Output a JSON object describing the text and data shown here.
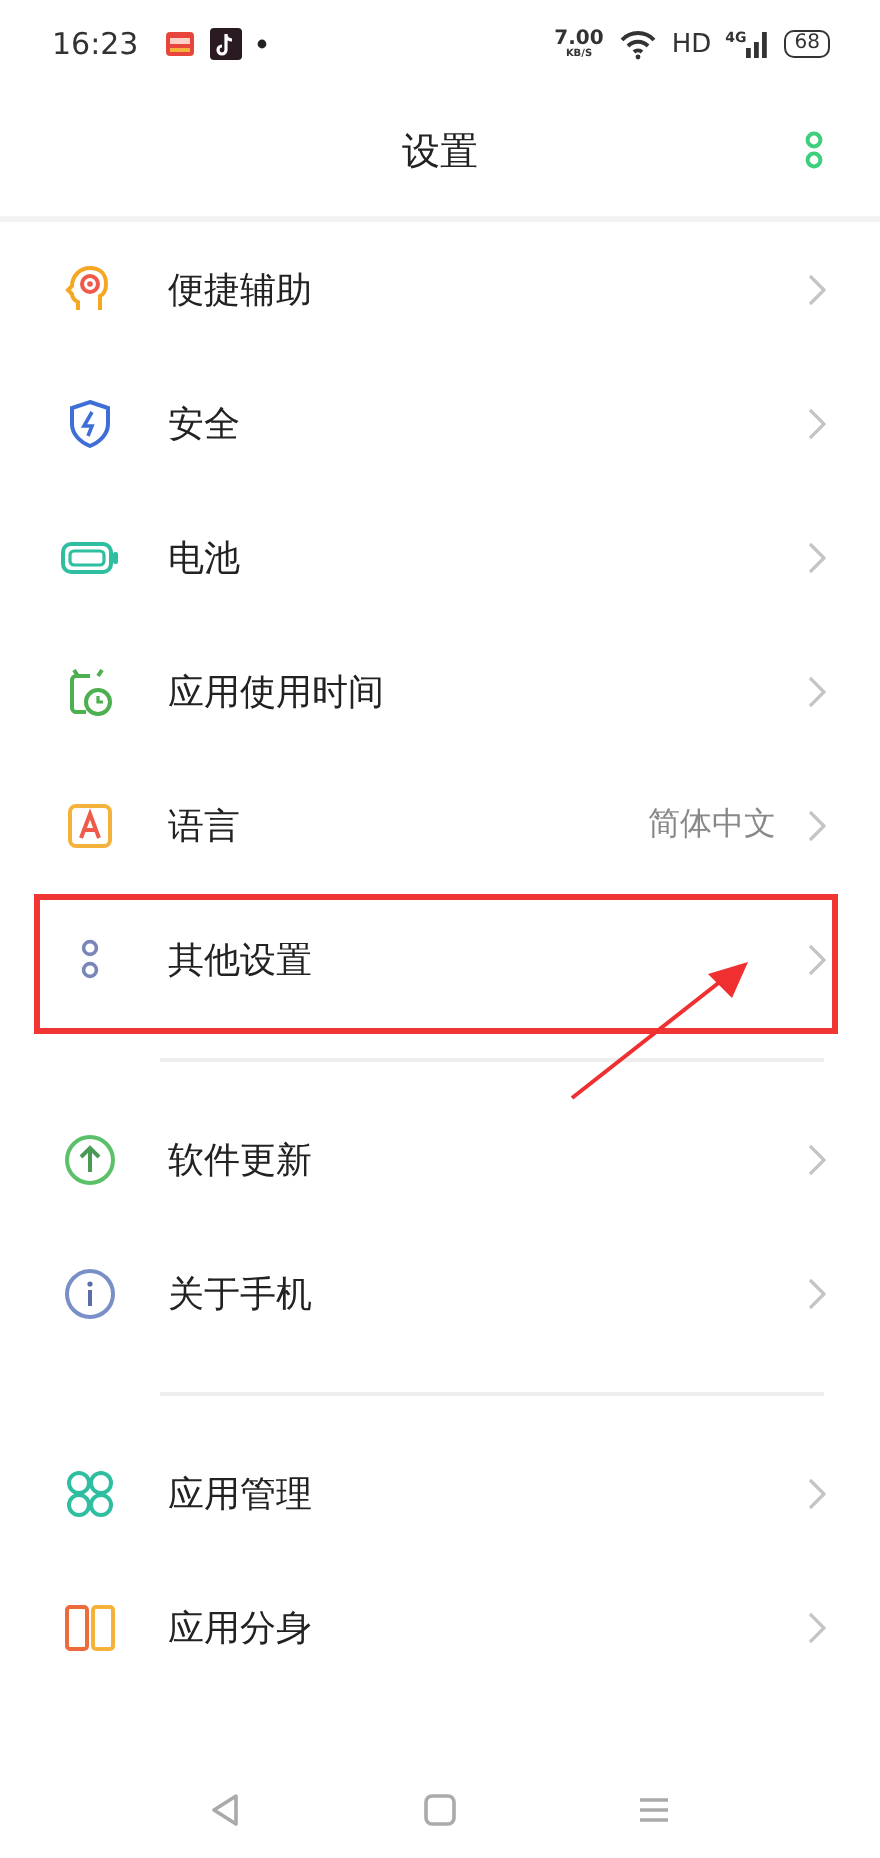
{
  "status_bar": {
    "time": "16:23",
    "net_speed": "7.00",
    "net_unit": "KB/S",
    "hd": "HD",
    "network": "4G",
    "battery": "68"
  },
  "header": {
    "title": "设置"
  },
  "sections": [
    {
      "items": [
        {
          "label": "便捷辅助",
          "highlighted": false
        },
        {
          "label": "安全",
          "highlighted": false
        },
        {
          "label": "电池",
          "highlighted": false
        },
        {
          "label": "应用使用时间",
          "highlighted": false
        },
        {
          "label": "语言",
          "value": "简体中文",
          "highlighted": false
        },
        {
          "label": "其他设置",
          "highlighted": true
        }
      ]
    },
    {
      "items": [
        {
          "label": "软件更新",
          "highlighted": false
        },
        {
          "label": "关于手机",
          "highlighted": false
        }
      ]
    },
    {
      "items": [
        {
          "label": "应用管理",
          "highlighted": false
        },
        {
          "label": "应用分身",
          "highlighted": false
        }
      ]
    }
  ]
}
